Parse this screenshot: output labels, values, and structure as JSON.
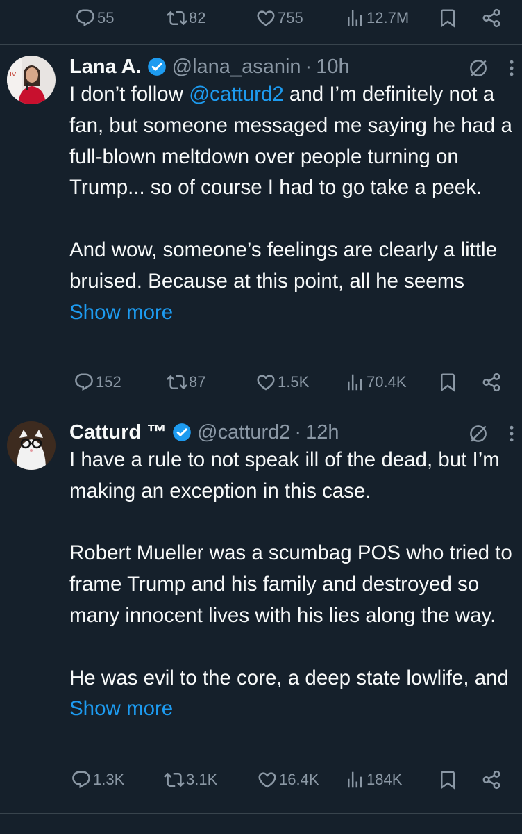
{
  "top_actions": {
    "replies": "55",
    "reposts": "82",
    "likes": "755",
    "views": "12.7M"
  },
  "tweet1": {
    "name": "Lana A.",
    "handle": "@lana_asanin",
    "separator": "·",
    "time": "10h",
    "text_l1_a": "I don’t follow ",
    "mention": "@catturd2",
    "text_l1_b": " and I’m definitely not a fan, but someone messaged me saying he had a full-blown meltdown over people turning on Trump... so of course I had to go take a peek.",
    "text_p2": "And wow, someone’s feelings are clearly a little bruised. Because at this point, all he seems ",
    "show_more": "Show more",
    "actions": {
      "replies": "152",
      "reposts": "87",
      "likes": "1.5K",
      "views": "70.4K"
    }
  },
  "tweet2": {
    "name": "Catturd ™",
    "handle": "@catturd2",
    "separator": "·",
    "time": "12h",
    "text_p1": "I have a rule to not speak ill of the dead, but I’m making an exception in this case.",
    "text_p2": "Robert Mueller was a scumbag POS who tried to frame Trump and his family and destroyed so many innocent lives with his lies along the way.",
    "text_p3": "He was evil to the core, a deep state lowlife, and ",
    "show_more": "Show more",
    "actions": {
      "replies": "1.3K",
      "reposts": "3.1K",
      "likes": "16.4K",
      "views": "184K"
    }
  },
  "colors": {
    "background": "#15202b",
    "text": "#f7f9f9",
    "muted": "#8b98a5",
    "link": "#1d9bf0",
    "divider": "#38444d"
  },
  "icons": [
    "reply-icon",
    "repost-icon",
    "like-icon",
    "views-icon",
    "bookmark-icon",
    "share-icon",
    "verified-badge-icon",
    "grok-icon",
    "more-icon"
  ]
}
